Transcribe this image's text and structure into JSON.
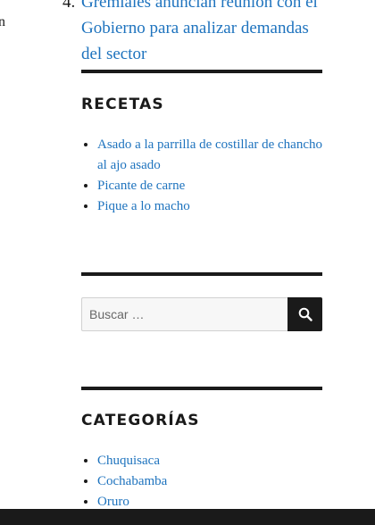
{
  "left_stub": {
    "text": "n"
  },
  "top_item": {
    "number": "4.",
    "link_text": "Gremiales anuncian reunión con el Gobierno para analizar demandas del sector"
  },
  "recetas": {
    "title": "RECETAS",
    "items": [
      {
        "label": "Asado a la parrilla de costillar de chancho al ajo asado"
      },
      {
        "label": "Picante de carne"
      },
      {
        "label": "Pique a lo macho"
      }
    ]
  },
  "search": {
    "placeholder": "Buscar …",
    "button_icon": "search-icon"
  },
  "categorias": {
    "title": "CATEGORÍAS",
    "items": [
      {
        "label": "Chuquisaca"
      },
      {
        "label": "Cochabamba"
      },
      {
        "label": "Oruro"
      }
    ]
  },
  "colors": {
    "link": "#1e73be",
    "text": "#1a1a1a",
    "input_bg": "#f7f7f7",
    "button_bg": "#1a1a1a"
  }
}
